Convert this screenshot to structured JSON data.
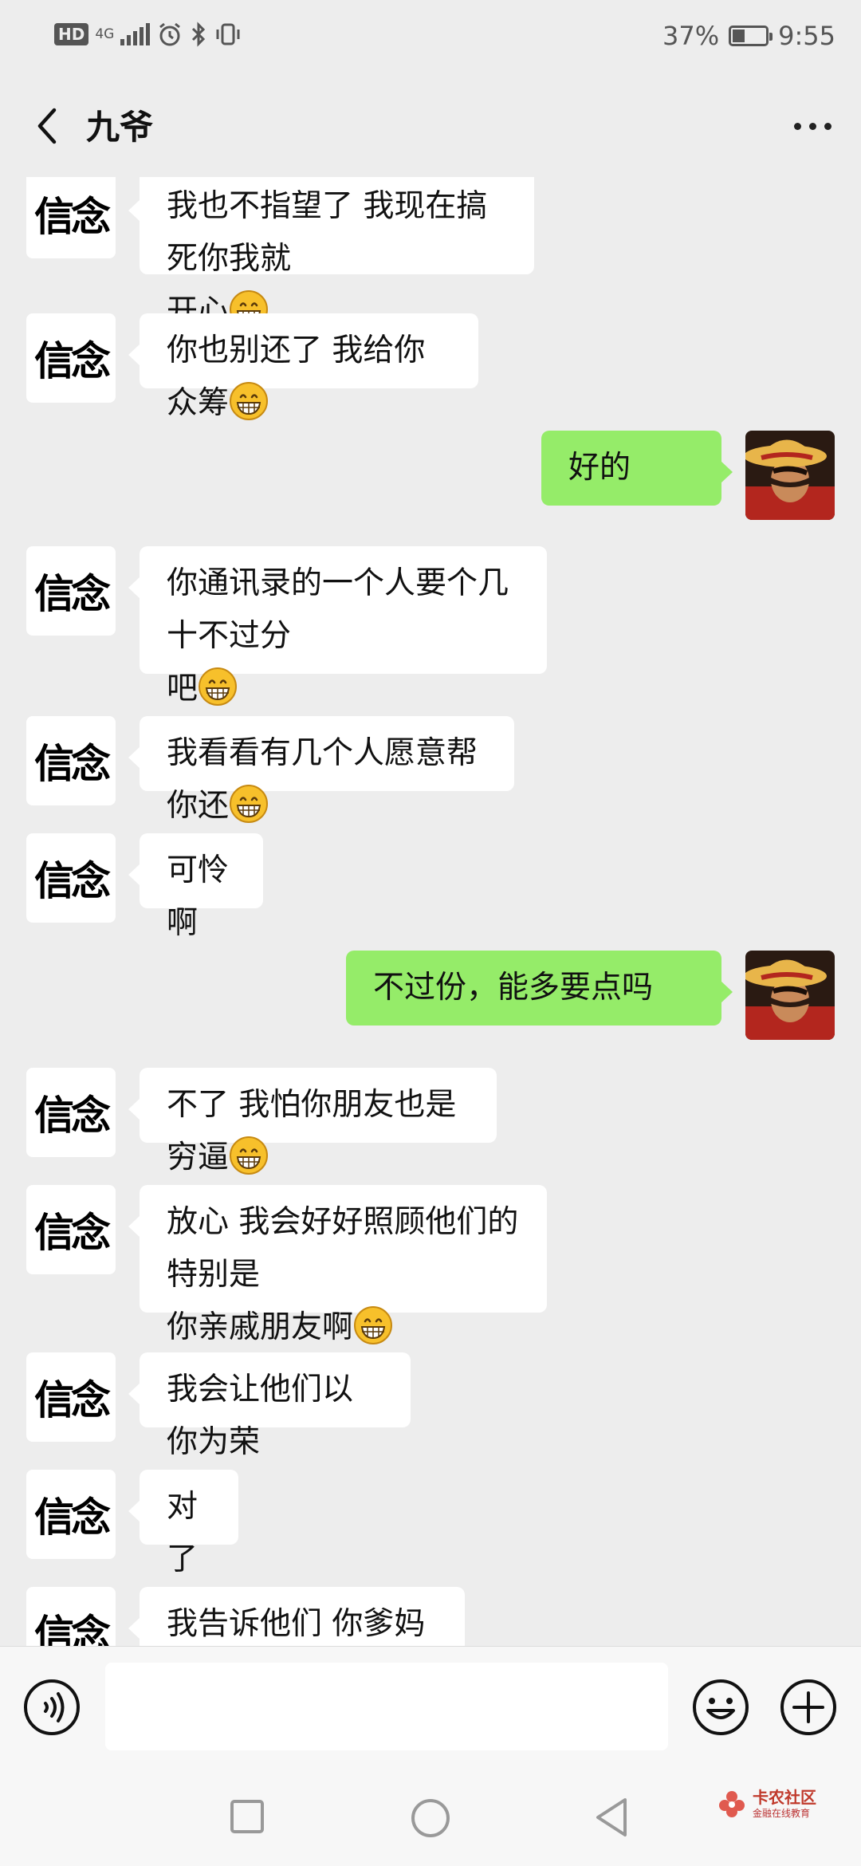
{
  "status_bar": {
    "hd_label": "HD",
    "network_label": "4G",
    "battery_percent": "37%",
    "battery_level": 0.37,
    "time": "9:55"
  },
  "header": {
    "title": "九爷"
  },
  "contacts": {
    "left_avatar_text": "信念"
  },
  "messages": [
    {
      "side": "in",
      "text": "我也不指望了 我现在搞死你我就\n开心",
      "emoji": true
    },
    {
      "side": "in",
      "text": "你也别还了 我给你众筹",
      "emoji": true
    },
    {
      "side": "out",
      "text": "好的",
      "emoji": false
    },
    {
      "side": "in",
      "text": "你通讯录的一个人要个几十不过分\n吧",
      "emoji": true
    },
    {
      "side": "in",
      "text": "我看看有几个人愿意帮你还",
      "emoji": true
    },
    {
      "side": "in",
      "text": "可怜啊",
      "emoji": false
    },
    {
      "side": "out",
      "text": "不过份，能多要点吗",
      "emoji": false
    },
    {
      "side": "in",
      "text": "不了 我怕你朋友也是穷逼",
      "emoji": true
    },
    {
      "side": "in",
      "text": "放心 我会好好照顾他们的 特别是\n你亲戚朋友啊",
      "emoji": true
    },
    {
      "side": "in",
      "text": "我会让他们以你为荣",
      "emoji": false
    },
    {
      "side": "in",
      "text": "对了",
      "emoji": false
    },
    {
      "side": "in",
      "text": "我告诉他们 你爹妈也借了",
      "emoji": false
    }
  ],
  "input_bar": {
    "placeholder": ""
  },
  "watermark": {
    "title": "卡农社区",
    "subtitle": "金融在线教育"
  },
  "icons": {
    "back": "chevron-left-icon",
    "more": "more-dots-icon",
    "voice": "voice-icon",
    "emoji": "emoji-icon",
    "plus": "plus-icon",
    "grin": "grin-emoji-icon"
  },
  "colors": {
    "background": "#ededed",
    "incoming_bubble": "#ffffff",
    "outgoing_bubble": "#95ec69",
    "bar": "#f7f7f7"
  }
}
